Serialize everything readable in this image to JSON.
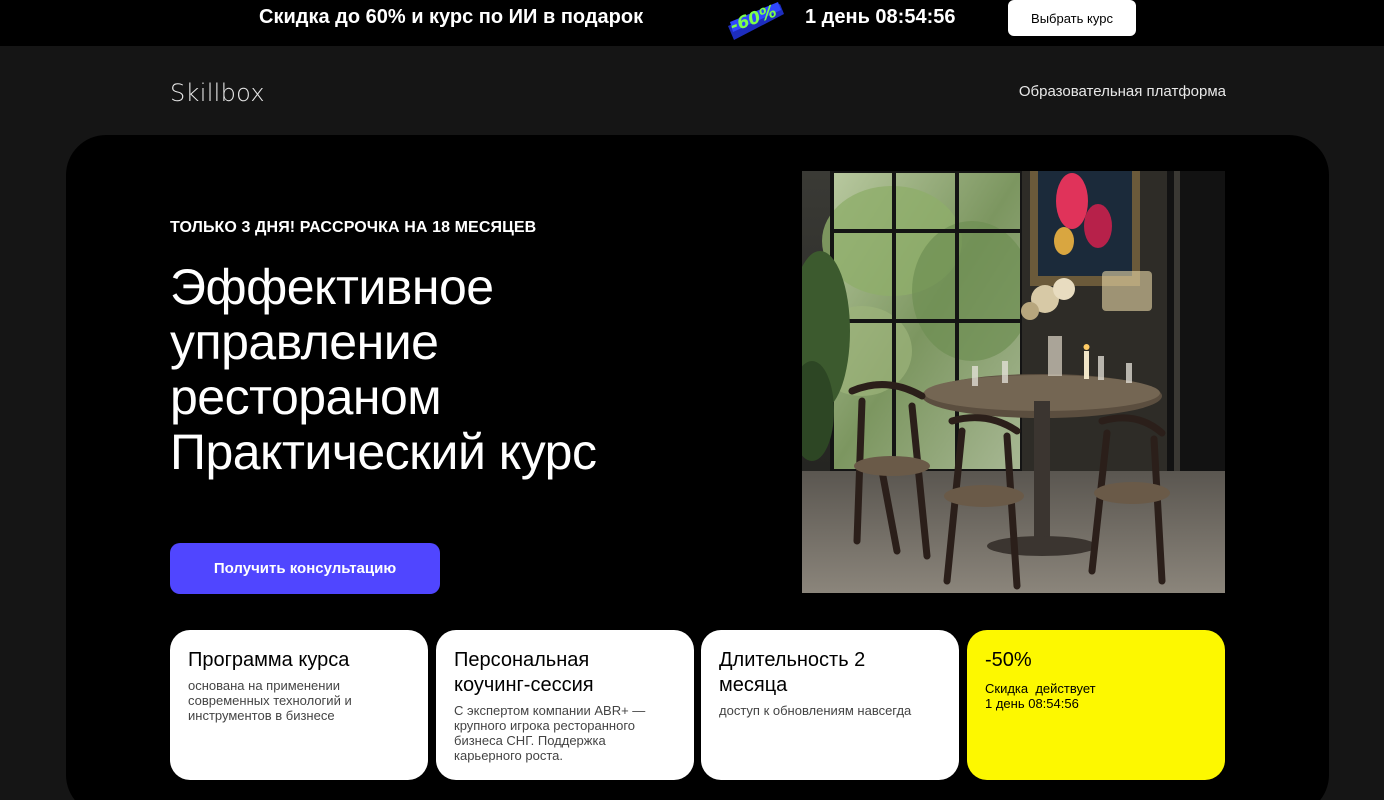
{
  "promo": {
    "text": "Скидка до 60% и курс по ИИ в подарок",
    "badge": "-60%",
    "timer": "1 день 08:54:56",
    "button": "Выбрать курс"
  },
  "header": {
    "logo": "Skillbox",
    "platform_link": "Образовательная платформа"
  },
  "hero": {
    "eyebrow": "ТОЛЬКО 3 ДНЯ! РАССРОЧКА НА 18 МЕСЯЦЕВ",
    "title_lines": [
      "Эффективное",
      "управление",
      "рестораном",
      "Практический курс"
    ],
    "cta": "Получить консультацию"
  },
  "cards": [
    {
      "title": "Программа курса",
      "desc": "основана на применении современных технологий и инструментов в бизнесе"
    },
    {
      "title": "Персональная коучинг-сессия",
      "desc": "С экспертом компании ABR+ — крупного игрока ресторанного бизнеса СНГ. Поддержка карьерного роста."
    },
    {
      "title": "Длительность 2 месяца",
      "desc": "доступ к обновлениям навсегда"
    },
    {
      "title": "-50%",
      "desc_label": "Скидка  действует",
      "desc_timer": "1 день 08:54:56"
    }
  ],
  "colors": {
    "page_bg": "#151515",
    "hero_bg": "#000000",
    "accent_button": "#5046ff",
    "discount_card": "#fdf800"
  }
}
